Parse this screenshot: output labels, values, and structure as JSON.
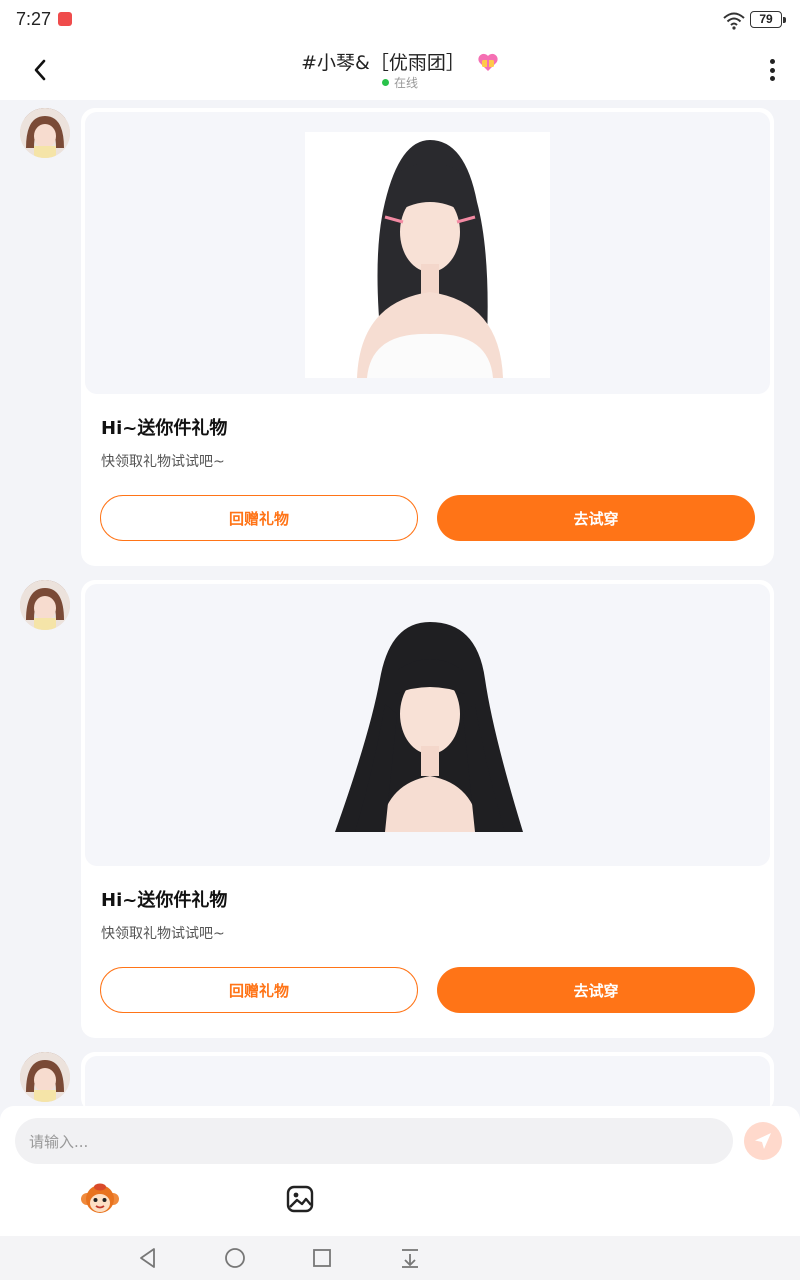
{
  "status_bar": {
    "time": "7:27",
    "battery": "79"
  },
  "header": {
    "title": "#小琴&［优雨团］",
    "status": "在线"
  },
  "messages": [
    {
      "title": "Hi~送你件礼物",
      "subtitle": "快领取礼物试试吧~",
      "return_gift_label": "回赠礼物",
      "try_on_label": "去试穿"
    },
    {
      "title": "Hi~送你件礼物",
      "subtitle": "快领取礼物试试吧~",
      "return_gift_label": "回赠礼物",
      "try_on_label": "去试穿"
    }
  ],
  "input": {
    "placeholder": "请输入..."
  },
  "colors": {
    "accent": "#ff7417",
    "online": "#29c24a",
    "background": "#f3f4f8"
  },
  "icons": {
    "back": "back-arrow-icon",
    "more": "more-vertical-icon",
    "send": "send-icon",
    "monkey": "monkey-emoji-icon",
    "image": "image-icon"
  }
}
